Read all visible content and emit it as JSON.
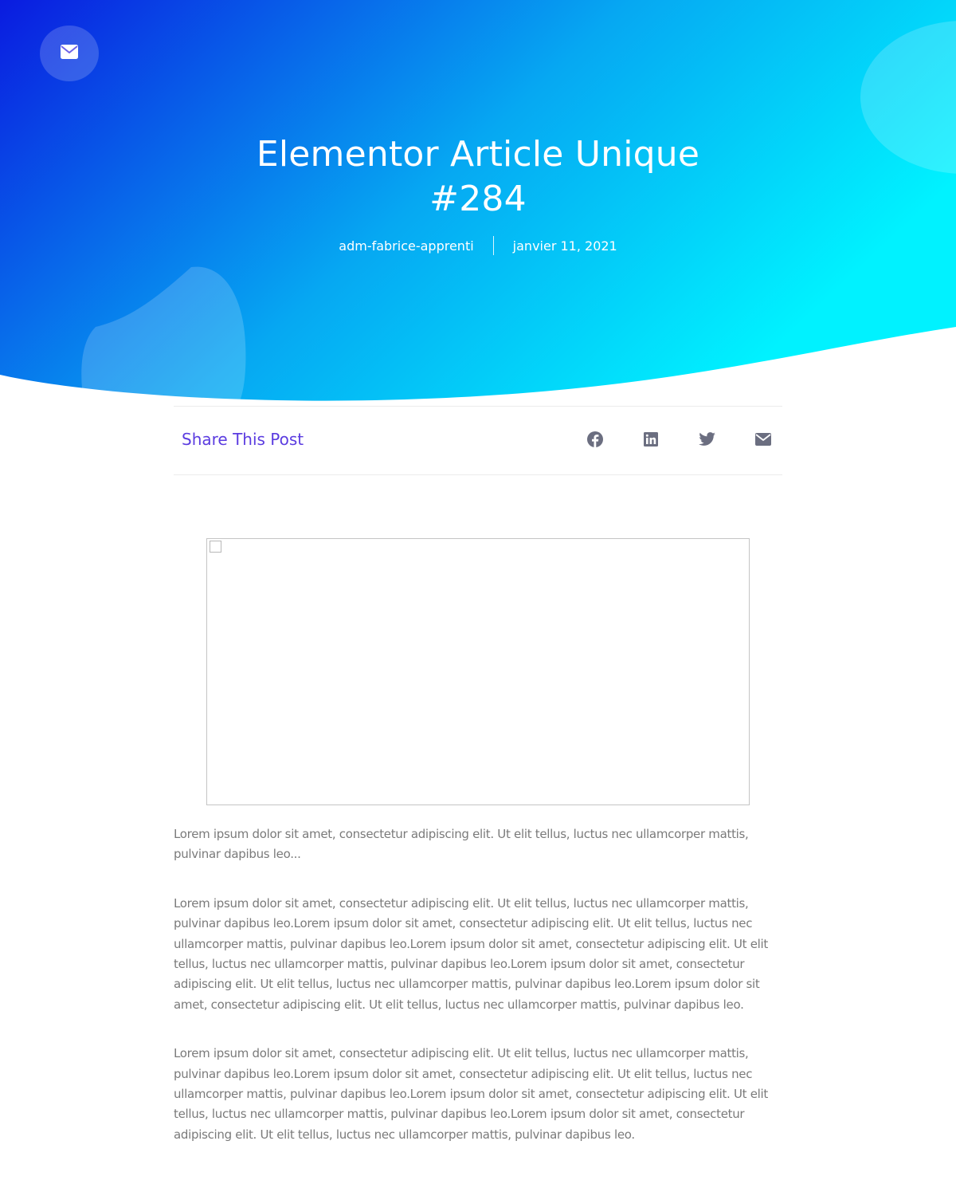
{
  "hero": {
    "title": "Elementor Article Unique #284",
    "author": "adm-fabrice-apprenti",
    "date": "janvier 11, 2021",
    "gradient_colors": [
      "#0a1be0",
      "#06a8f2",
      "#00f2ff"
    ]
  },
  "header": {
    "contact_icon": "envelope-icon"
  },
  "share": {
    "title": "Share This Post",
    "title_color": "#5b3ce0",
    "icons": [
      "facebook-icon",
      "linkedin-icon",
      "twitter-icon",
      "envelope-icon"
    ],
    "icon_color": "#6b6e80"
  },
  "featured_image": {
    "state": "broken-image"
  },
  "article": {
    "paragraphs": [
      "Lorem ipsum dolor sit amet, consectetur adipiscing elit. Ut elit tellus, luctus nec ullamcorper mattis, pulvinar dapibus leo...",
      "Lorem ipsum dolor sit amet, consectetur adipiscing elit. Ut elit tellus, luctus nec ullamcorper mattis, pulvinar dapibus leo.Lorem ipsum dolor sit amet, consectetur adipiscing elit. Ut elit tellus, luctus nec ullamcorper mattis, pulvinar dapibus leo.Lorem ipsum dolor sit amet, consectetur adipiscing elit. Ut elit tellus, luctus nec ullamcorper mattis, pulvinar dapibus leo.Lorem ipsum dolor sit amet, consectetur adipiscing elit. Ut elit tellus, luctus nec ullamcorper mattis, pulvinar dapibus leo.Lorem ipsum dolor sit amet, consectetur adipiscing elit. Ut elit tellus, luctus nec ullamcorper mattis, pulvinar dapibus leo.",
      "Lorem ipsum dolor sit amet, consectetur adipiscing elit. Ut elit tellus, luctus nec ullamcorper mattis, pulvinar dapibus leo.Lorem ipsum dolor sit amet, consectetur adipiscing elit. Ut elit tellus, luctus nec ullamcorper mattis, pulvinar dapibus leo.Lorem ipsum dolor sit amet, consectetur adipiscing elit. Ut elit tellus, luctus nec ullamcorper mattis, pulvinar dapibus leo.Lorem ipsum dolor sit amet, consectetur adipiscing elit. Ut elit tellus, luctus nec ullamcorper mattis, pulvinar dapibus leo."
    ]
  }
}
